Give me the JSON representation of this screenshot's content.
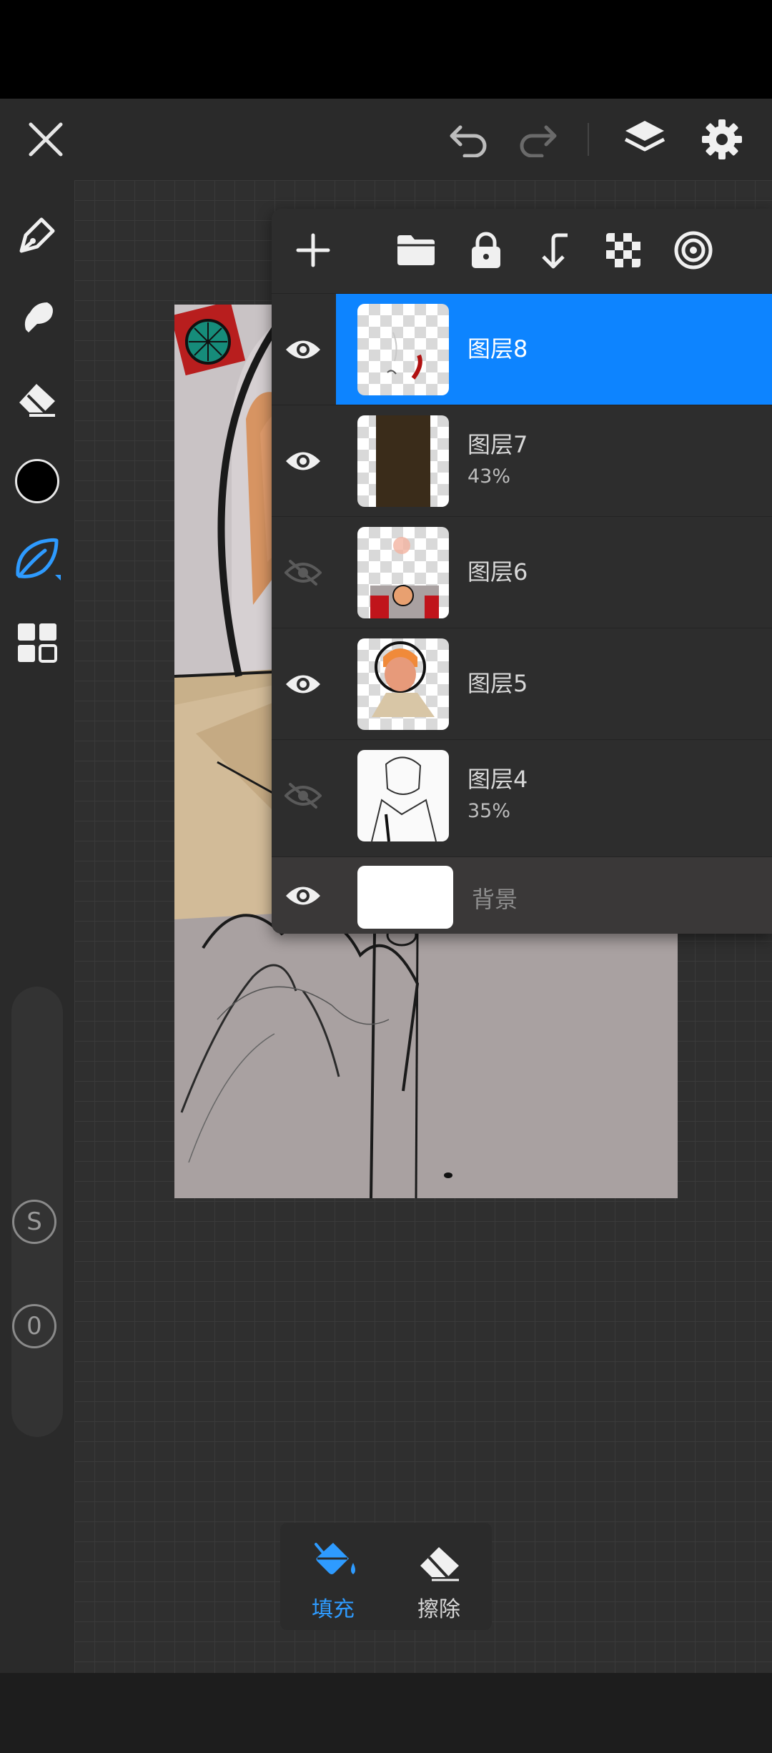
{
  "app": {
    "accent_color": "#0d84ff"
  },
  "toolbar": {
    "close_icon": "close-icon",
    "undo_icon": "undo-icon",
    "redo_icon": "redo-icon",
    "layers_icon": "layers-icon",
    "settings_icon": "gear-icon"
  },
  "left_rail": {
    "tools": [
      "brush-icon",
      "smudge-icon",
      "eraser-icon",
      "color-swatch",
      "fill-leaf-icon",
      "grid-menu-icon"
    ],
    "current_color": "#000000",
    "size_slider_label": "S",
    "opacity_slider_label": "0"
  },
  "layers_panel": {
    "tools": [
      "add-layer-icon",
      "folder-icon",
      "lock-icon",
      "merge-down-icon",
      "transparency-icon",
      "target-icon"
    ],
    "layers": [
      {
        "name": "图层8",
        "opacity": "",
        "visible": true,
        "selected": true
      },
      {
        "name": "图层7",
        "opacity": "43%",
        "visible": true,
        "selected": false
      },
      {
        "name": "图层6",
        "opacity": "",
        "visible": false,
        "selected": false
      },
      {
        "name": "图层5",
        "opacity": "",
        "visible": true,
        "selected": false
      },
      {
        "name": "图层4",
        "opacity": "35%",
        "visible": false,
        "selected": false
      }
    ],
    "background": {
      "name": "背景",
      "visible": true
    }
  },
  "bottom_bar": {
    "fill_label": "填充",
    "erase_label": "擦除",
    "active": "fill"
  }
}
